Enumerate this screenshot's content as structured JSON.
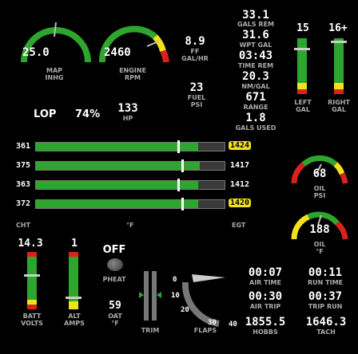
{
  "gauges": {
    "map": {
      "value": "25.0",
      "label1": "MAP",
      "label2": "INHG"
    },
    "rpm": {
      "value": "2460",
      "label1": "ENGINE",
      "label2": "RPM"
    },
    "ff": {
      "value": "8.9",
      "label1": "FF",
      "label2": "GAL/HR"
    },
    "fuel_psi": {
      "value": "23",
      "label1": "FUEL",
      "label2": "PSI"
    },
    "oil_psi": {
      "value": "68",
      "label1": "OIL",
      "label2": "PSI"
    },
    "oil_temp": {
      "value": "188",
      "label1": "OIL",
      "label2": "°F"
    }
  },
  "fuel_calc": {
    "gals_rem": {
      "value": "33.1",
      "label": "GALS REM"
    },
    "wpt_gal": {
      "value": "31.6",
      "label": "WPT GAL"
    },
    "time_rem": {
      "value": "03:43",
      "label": "TIME REM"
    },
    "nm_gal": {
      "value": "20.3",
      "label": "NM/GAL"
    },
    "range": {
      "value": "671",
      "label": "RANGE"
    },
    "gals_used": {
      "value": "1.8",
      "label": "GALS USED"
    }
  },
  "tanks": {
    "left": {
      "value": "15",
      "label1": "LEFT",
      "label2": "GAL"
    },
    "right": {
      "value": "16+",
      "label1": "RIGHT",
      "label2": "GAL"
    }
  },
  "lean": {
    "mode": "LOP",
    "pct": "74%",
    "hp": "133",
    "hp_label": "HP"
  },
  "cylinders": [
    {
      "cht": "361",
      "egt": "1424",
      "egt_hl": true,
      "fill": 0.86,
      "mark": 0.75
    },
    {
      "cht": "375",
      "egt": "1417",
      "egt_hl": false,
      "fill": 0.87,
      "mark": 0.77
    },
    {
      "cht": "363",
      "egt": "1412",
      "egt_hl": false,
      "fill": 0.86,
      "mark": 0.75
    },
    {
      "cht": "372",
      "egt": "1420",
      "egt_hl": true,
      "fill": 0.86,
      "mark": 0.77
    }
  ],
  "cyl_axis": {
    "left": "CHT",
    "mid": "°F",
    "right": "EGT"
  },
  "batt": {
    "value": "14.3",
    "label1": "BATT",
    "label2": "VOLTS"
  },
  "alt": {
    "value": "1",
    "label1": "ALT",
    "label2": "AMPS"
  },
  "pheat": {
    "value": "OFF",
    "label": "PHEAT"
  },
  "oat": {
    "value": "59",
    "label1": "OAT",
    "label2": "°F"
  },
  "trim": {
    "label": "TRIM"
  },
  "flaps": {
    "label": "FLAPS",
    "ticks": [
      "0",
      "10",
      "20",
      "30",
      "40"
    ]
  },
  "timers": {
    "air_time": {
      "value": "00:07",
      "label": "AIR TIME"
    },
    "run_time": {
      "value": "00:11",
      "label": "RUN TIME"
    },
    "air_trip": {
      "value": "00:30",
      "label": "AIR TRIP"
    },
    "trip_run": {
      "value": "00:37",
      "label": "TRIP RUN"
    },
    "hobbs": {
      "value": "1855.5",
      "label": "HOBBS"
    },
    "tach": {
      "value": "1646.3",
      "label": "TACH"
    }
  },
  "colors": {
    "green": "#2ea52e",
    "yellow": "#f2e21c",
    "red": "#d9221c",
    "gray": "#3a3a3a",
    "label": "#aaaaaa"
  }
}
